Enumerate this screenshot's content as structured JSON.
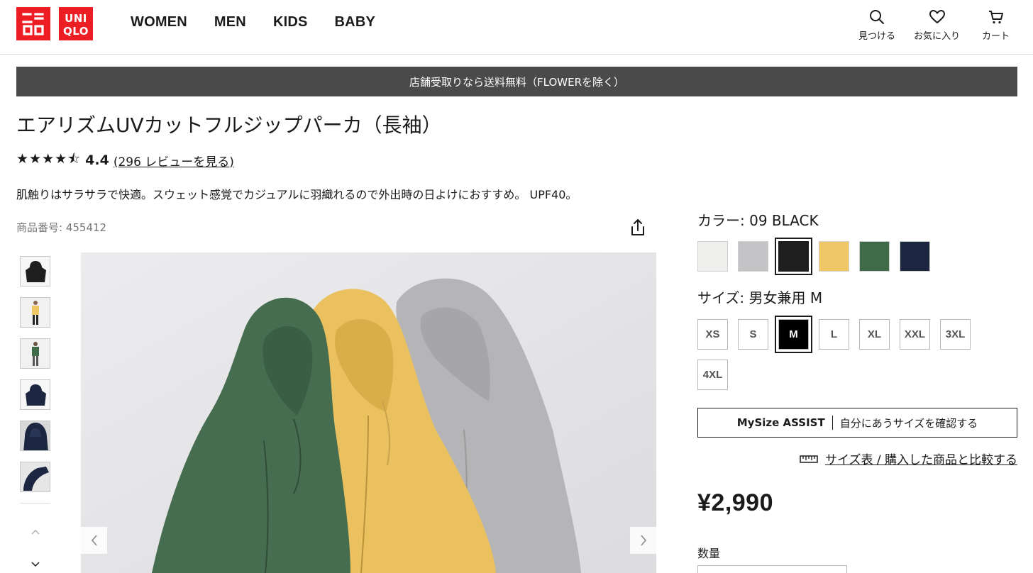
{
  "header": {
    "logo_top": "ユニクロ",
    "logo_bottom": "UNI QLO",
    "nav": [
      "WOMEN",
      "MEN",
      "KIDS",
      "BABY"
    ],
    "tools": {
      "search": "見つける",
      "favorites": "お気に入り",
      "cart": "カート"
    }
  },
  "banner": {
    "text": "店舗受取りなら送料無料（FLOWERを除く）"
  },
  "product": {
    "title": "エアリズムUVカットフルジップパーカ（長袖）",
    "stars": "★★★★⯪",
    "rating_value": "4.4",
    "rating_link": "(296 レビューを見る)",
    "rating": 4.4,
    "description": "肌触りはサラサラで快適。スウェット感覚でカジュアルに羽織れるので外出時の日よけにおすすめ。 UPF40。",
    "sku": "商品番号: 455412",
    "color_label": "カラー:  09 BLACK",
    "colors": [
      {
        "name": "off-white",
        "hex": "#efefed"
      },
      {
        "name": "gray",
        "hex": "#c4c4c6"
      },
      {
        "name": "black",
        "hex": "#1e1e1e"
      },
      {
        "name": "yellow",
        "hex": "#efc766"
      },
      {
        "name": "green",
        "hex": "#3f6b48"
      },
      {
        "name": "navy",
        "hex": "#1c2640"
      }
    ],
    "selected_color": "black",
    "size_label": "サイズ:  男女兼用 M",
    "sizes": [
      "XS",
      "S",
      "M",
      "L",
      "XL",
      "XXL",
      "3XL",
      "4XL"
    ],
    "selected_size": "M",
    "mysize": {
      "title": "MySize ASSIST",
      "text": "自分にあうサイズを確認する"
    },
    "size_table_link": "サイズ表 / 購入した商品と比較する",
    "price": "¥2,990",
    "quantity_label": "数量"
  },
  "colors": {
    "brand": "#ed1d24",
    "banner_bg": "#4a4a4a",
    "text": "#1b1b1b"
  }
}
